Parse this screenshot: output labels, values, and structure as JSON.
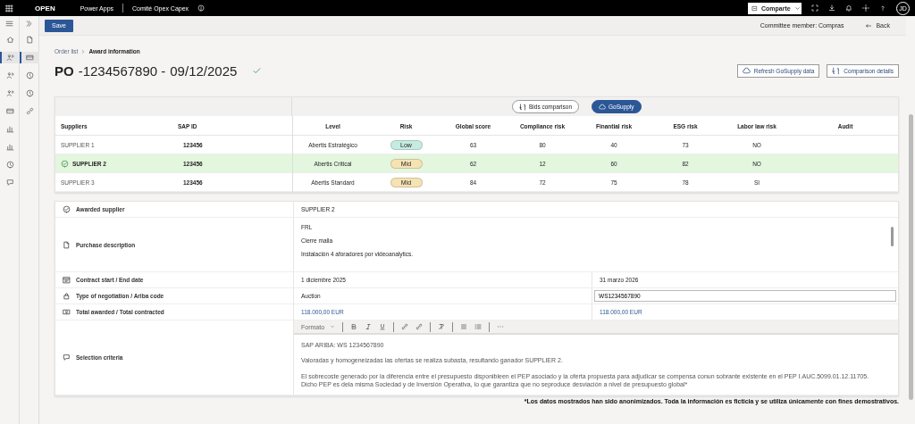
{
  "topbar": {
    "brand": "OPEN",
    "app": "Power Apps",
    "environment": "Comité Opex Capex",
    "share_button": "Comparte",
    "avatar": "JD"
  },
  "nav_rail": [
    {
      "selected": false
    },
    {
      "selected": true
    },
    {
      "selected": false
    },
    {
      "selected": false
    },
    {
      "selected": false
    },
    {
      "selected": false
    },
    {
      "selected": false
    },
    {
      "selected": false
    },
    {
      "selected": false
    }
  ],
  "sub_rail": [
    {
      "selected": false
    },
    {
      "selected": true
    },
    {
      "selected": false
    },
    {
      "selected": false
    },
    {
      "selected": false
    }
  ],
  "command_bar": {
    "save": "Save",
    "committee_member": "Committee member: Compras",
    "back": "Back"
  },
  "breadcrumb": [
    {
      "label": "Order list"
    },
    {
      "label": "Award information"
    }
  ],
  "title": {
    "prefix": "PO",
    "number": "-1234567890 -",
    "date": "09/12/2025"
  },
  "actions": [
    "Refresh GoSupply data",
    "Comparison details"
  ],
  "view_toggle": [
    {
      "label": "Bids comparison",
      "selected": false
    },
    {
      "label": "GoSupply",
      "selected": true
    }
  ],
  "table": {
    "columns": [
      "Suppliers",
      "SAP ID",
      "Level",
      "Risk",
      "Global score",
      "Compliance risk",
      "Finantial risk",
      "ESG risk",
      "Labor law risk",
      "Audit"
    ],
    "rows": [
      {
        "supplier": "SUPPLIER 1",
        "sap_id": "123456",
        "level": "Abertis Estratégico",
        "risk": {
          "label": "Low",
          "color": "#c6ebe1"
        },
        "global_score": "63",
        "compliance_risk": "80",
        "finantial_risk": "40",
        "esg_risk": "73",
        "labor_law_risk": "NO",
        "selected": false
      },
      {
        "supplier": "SUPPLIER 2",
        "sap_id": "123456",
        "level": "Abertis Critical",
        "risk": {
          "label": "Mid",
          "color": "#f6e3b4"
        },
        "global_score": "62",
        "compliance_risk": "12",
        "finantial_risk": "60",
        "esg_risk": "82",
        "labor_law_risk": "NO",
        "selected": true
      },
      {
        "supplier": "SUPPLIER 3",
        "sap_id": "123456",
        "level": "Abertis Standard",
        "risk": {
          "label": "Mid",
          "color": "#f6e3b4"
        },
        "global_score": "84",
        "compliance_risk": "72",
        "finantial_risk": "75",
        "esg_risk": "78",
        "labor_law_risk": "SI",
        "selected": false
      }
    ]
  },
  "details": [
    {
      "kind": "text",
      "label": "Awarded supplier",
      "value": "SUPPLIER 2"
    },
    {
      "kind": "lines",
      "label": "Purchase description",
      "lines": [
        "FRL",
        "Cierre malla",
        "Instalación 4 aforadores por videoanalytics."
      ]
    },
    {
      "kind": "pair",
      "label": "Contract start / End date",
      "value": "1 diciembre 2025",
      "value_2": "31 marzo 2026"
    },
    {
      "kind": "input",
      "label": "Type of negotiation / Ariba code",
      "value": "Auction",
      "input_value": "WS1234567890"
    },
    {
      "kind": "amounts",
      "label": "Total awarded / Total contracted",
      "value": "118.000,00  EUR",
      "value_2": "118.000,00 EUR"
    },
    {
      "kind": "editor",
      "label": "Selection criteria",
      "format": "Formato",
      "paragraphs": [
        "SAP ARIBA: WS 1234567890",
        "Valoradas y homogeneizadas las ofertas se realiza subasta, resultando ganador SUPPLIER 2.",
        "El sobrecoste generado por la diferencia entre el presupuesto disponibleen el PEP asociado y la oferta propuesta para adjudicar se compensa conun sobrante existente en el PEP I.AUC.5099.01.12.11705. Dicho PEP es dela misma Sociedad y de Inversión Operativa, lo que garantiza que no seproduce desviación a nivel de presupuesto global*"
      ]
    }
  ],
  "footnote": "*Los datos mostrados han sido anonimizados. Toda la información es ficticia y se utiliza únicamente con fines demostrativos."
}
